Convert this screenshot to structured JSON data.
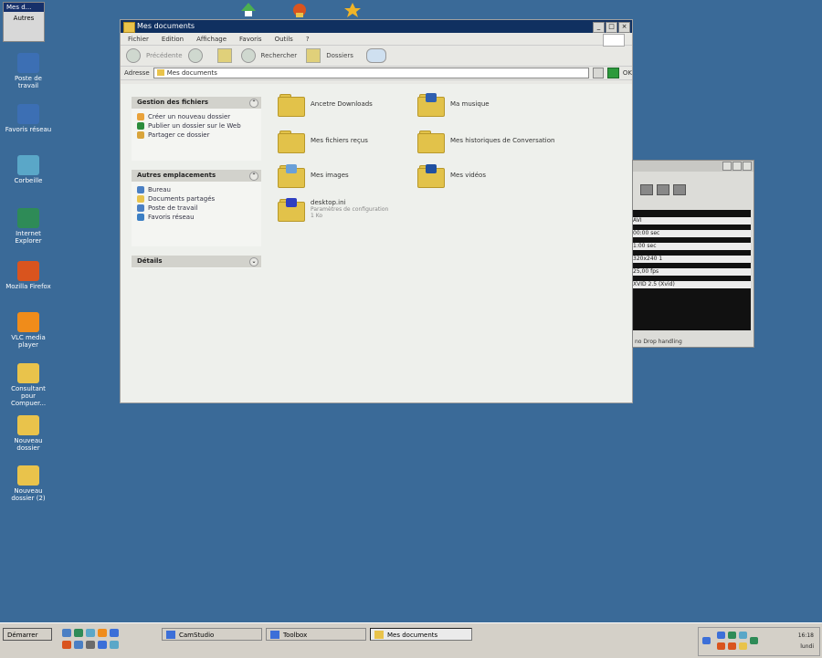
{
  "desktop": {
    "top_selected": {
      "title": "Mes d...",
      "label": "Autres"
    },
    "icons": [
      {
        "label": "Poste de travail",
        "color": "#3c6fb4"
      },
      {
        "label": "Favoris réseau",
        "color": "#3c6fb4"
      },
      {
        "label": "Corbeille",
        "color": "#5aa7c8"
      },
      {
        "label": "Internet Explorer",
        "color": "#2e8b57"
      },
      {
        "label": "Mozilla Firefox",
        "color": "#d9541e"
      },
      {
        "label": "VLC media player",
        "color": "#f08c1a"
      },
      {
        "label": "Consultant pour Compuer...",
        "color": "#e9c34b"
      },
      {
        "label": "Nouveau dossier",
        "color": "#e9c34b"
      },
      {
        "label": "Nouveau dossier (2)",
        "color": "#e9c34b"
      }
    ]
  },
  "window": {
    "title": "Mes documents",
    "menu": [
      "Fichier",
      "Edition",
      "Affichage",
      "Favoris",
      "Outils",
      "?"
    ],
    "toolbar": {
      "back": "Précédente",
      "search": "Rechercher",
      "folders": "Dossiers"
    },
    "address": {
      "label": "Adresse",
      "value": "Mes documents",
      "go": "OK"
    },
    "pane": {
      "tasks_title": "Gestion des fichiers",
      "tasks": [
        {
          "label": "Créer un nouveau dossier",
          "color": "#e9a23b"
        },
        {
          "label": "Publier un dossier sur le Web",
          "color": "#2c8c3c"
        },
        {
          "label": "Partager ce dossier",
          "color": "#d9a43b"
        }
      ],
      "places_title": "Autres emplacements",
      "places": [
        {
          "label": "Bureau",
          "color": "#4a7fc4"
        },
        {
          "label": "Documents partagés",
          "color": "#e9c34b"
        },
        {
          "label": "Poste de travail",
          "color": "#4a7fc4"
        },
        {
          "label": "Favoris réseau",
          "color": "#3c7fc4"
        }
      ],
      "details_title": "Détails"
    },
    "folders": [
      {
        "label": "Ancetre Downloads",
        "deco": ""
      },
      {
        "label": "Ma musique",
        "deco": "#3060b0"
      },
      {
        "label": "Mes fichiers reçus",
        "deco": ""
      },
      {
        "label": "Mes historiques de Conversation",
        "deco": ""
      },
      {
        "label": "Mes images",
        "deco": "#6aa0d8"
      },
      {
        "label": "Mes vidéos",
        "deco": "#2050a0"
      },
      {
        "label": "desktop.ini",
        "deco": "#3040c0",
        "sub1": "Paramètres de configuration",
        "sub2": "1 Ko"
      }
    ]
  },
  "media_window": {
    "rows": [
      "AVI",
      "00:00 sec",
      "1:00 sec",
      "320x240 1",
      "25,00 fps",
      "XVID 2.5 (Xvid)"
    ],
    "status": "no Drop handling"
  },
  "taskbar": {
    "start": "Démarrer",
    "tasks": [
      {
        "label": "CamStudio",
        "color": "#3c6fd8"
      },
      {
        "label": "Toolbox",
        "color": "#3c6fd8"
      },
      {
        "label": "Mes documents",
        "color": "#e9c34b"
      }
    ],
    "quicklaunch": [
      "#4a7fc4",
      "#2e8b57",
      "#5aa7c8",
      "#f08c1a",
      "#3c6fd8",
      "#d9541e",
      "#4a7fc4",
      "#6b6b6b",
      "#3c6fd8",
      "#5aa7c8"
    ],
    "clock": {
      "time": "16:18",
      "day": "lundi"
    }
  }
}
